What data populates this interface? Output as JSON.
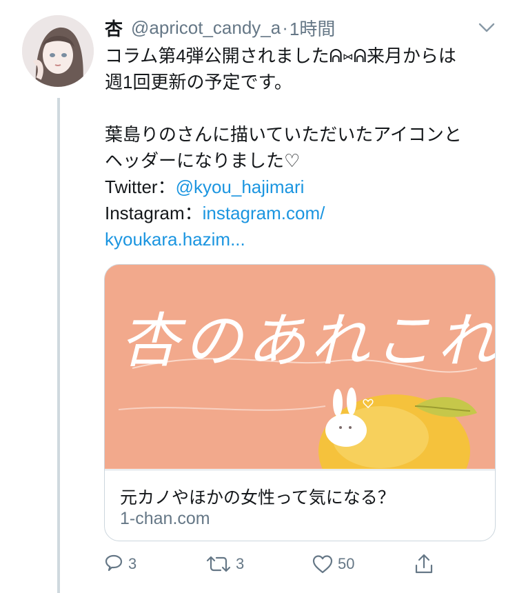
{
  "tweet": {
    "name": "杏",
    "handle": "@apricot_candy_a",
    "separator": "·",
    "time": "1時間",
    "lines": [
      "コラム第4弾公開されましたᕱ⑅ᕱ来月からは",
      "週1回更新の予定です。",
      "",
      "葉島りのさんに描いていただいたアイコンと",
      "ヘッダーになりました♡"
    ],
    "twitter_label": "Twitter：",
    "twitter_link": "@kyou_hajimari",
    "instagram_label": "Instagram：",
    "instagram_link": "instagram.com/",
    "instagram_link_cont": "kyoukara.hazim..."
  },
  "card": {
    "image_text": "杏のあれこれ",
    "title": "元カノやほかの女性って気になる？",
    "domain": "1-chan.com"
  },
  "actions": {
    "reply_count": "3",
    "retweet_count": "3",
    "like_count": "50"
  },
  "colors": {
    "link": "#1b95e0",
    "muted": "#657786",
    "card_bg": "#f2a98c",
    "thread_line": "#cfd9de"
  }
}
